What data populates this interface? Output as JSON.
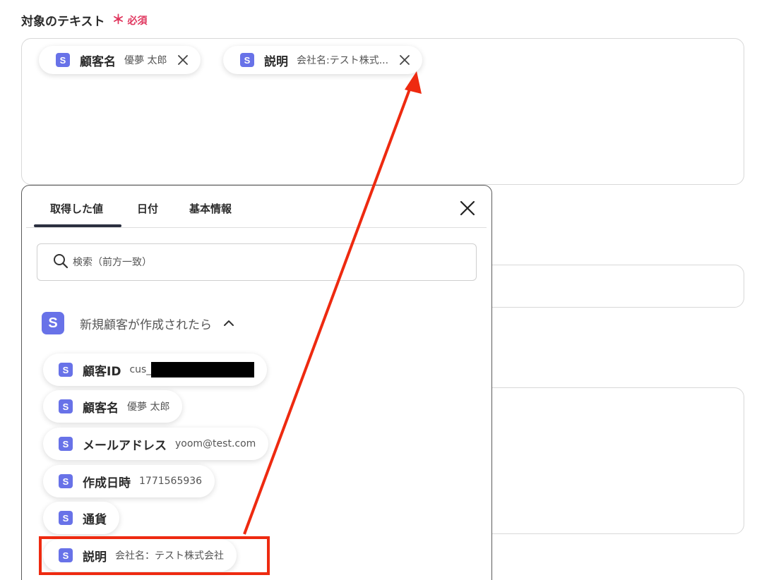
{
  "field": {
    "label": "対象のテキスト",
    "required_star": "＊",
    "required_text": "必須"
  },
  "selected_chips": [
    {
      "icon": "S",
      "name": "顧客名",
      "value": "優夢 太郎"
    },
    {
      "icon": "S",
      "name": "説明",
      "value": "会社名:テスト株式..."
    }
  ],
  "popup": {
    "tabs": [
      {
        "label": "取得した値",
        "active": true
      },
      {
        "label": "日付",
        "active": false
      },
      {
        "label": "基本情報",
        "active": false
      }
    ],
    "search_placeholder": "検索（前方一致）",
    "section": {
      "icon": "S",
      "title": "新規顧客が作成されたら"
    },
    "items": [
      {
        "icon": "S",
        "name": "顧客ID",
        "value": "cus_",
        "redacted": true
      },
      {
        "icon": "S",
        "name": "顧客名",
        "value": "優夢 太郎"
      },
      {
        "icon": "S",
        "name": "メールアドレス",
        "value": "yoom@test.com"
      },
      {
        "icon": "S",
        "name": "作成日時",
        "value": "1771565936"
      },
      {
        "icon": "S",
        "name": "通貨",
        "value": ""
      },
      {
        "icon": "S",
        "name": "説明",
        "value": "会社名：テスト株式会社"
      }
    ]
  },
  "colors": {
    "accent": "#6872e8",
    "required": "#e0375f",
    "annotation": "#ee2a10"
  }
}
